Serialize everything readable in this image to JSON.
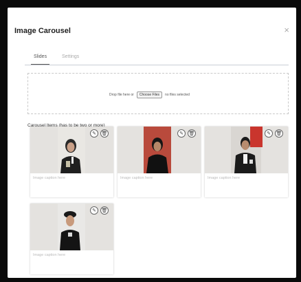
{
  "dialog": {
    "title": "Image Carousel",
    "close_glyph": "×"
  },
  "tabs": [
    {
      "label": "Slides",
      "active": true
    },
    {
      "label": "Settings",
      "active": false
    }
  ],
  "dropzone": {
    "text_before": "Drop file here or",
    "button_label": "Choose Files",
    "text_after": "no files selected"
  },
  "items_label": "Carousel Items (has to be two or more)",
  "items": [
    {
      "caption_placeholder": "Image caption here",
      "edit_icon": "pencil-icon",
      "delete_icon": "trash-icon"
    },
    {
      "caption_placeholder": "Image caption here",
      "edit_icon": "pencil-icon",
      "delete_icon": "trash-icon"
    },
    {
      "caption_placeholder": "Image caption here",
      "edit_icon": "pencil-icon",
      "delete_icon": "trash-icon"
    },
    {
      "caption_placeholder": "Image caption here",
      "edit_icon": "pencil-icon",
      "delete_icon": "trash-icon"
    }
  ],
  "colors": {
    "background": "#0a0a0a",
    "dialog": "#ffffff",
    "tab_underline": "#555555",
    "caption_placeholder": "#bbbbbb"
  }
}
